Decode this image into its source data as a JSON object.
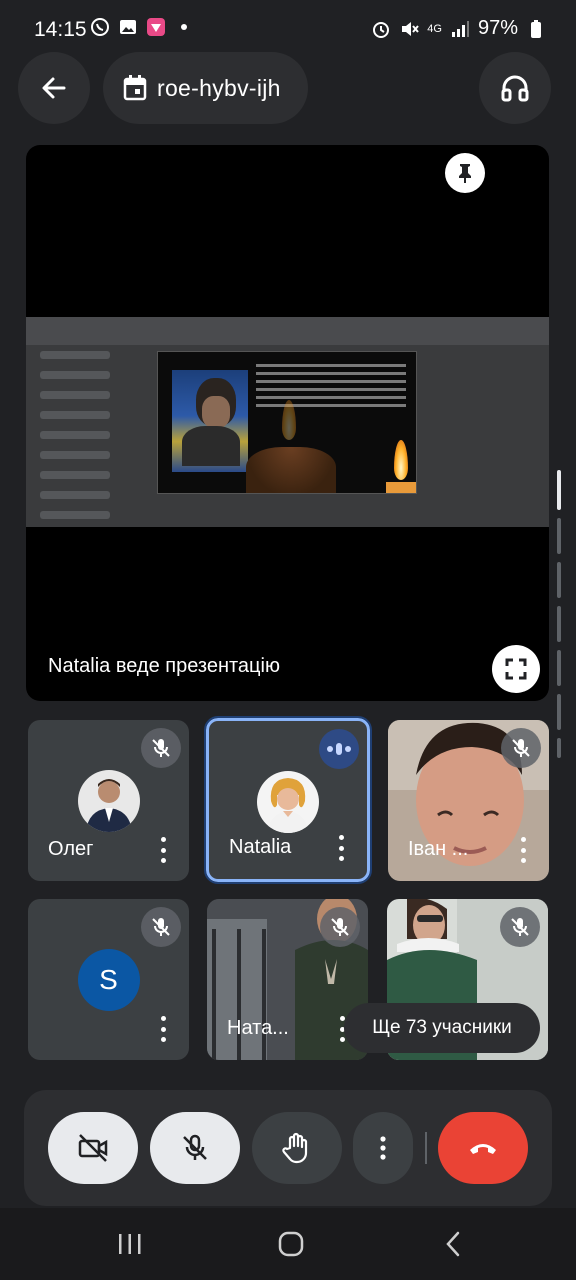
{
  "status_bar": {
    "time": "14:15",
    "battery": "97%",
    "network": "4G",
    "icons_left": [
      "viber-icon",
      "gallery-icon",
      "app-icon"
    ],
    "icons_right": [
      "alarm-icon",
      "mute-icon",
      "signal-icon",
      "battery-icon"
    ]
  },
  "top_bar": {
    "meeting_code": "roe-hybv-ijh",
    "back_icon": "arrow-back-icon",
    "calendar_icon": "calendar-icon",
    "audio_icon": "headphones-icon"
  },
  "presentation": {
    "label": "Natalia веде презентацію",
    "pin_icon": "pin-icon",
    "fullscreen_icon": "fullscreen-icon"
  },
  "participants": [
    {
      "name": "Олег",
      "muted": true,
      "avatar": "photo"
    },
    {
      "name": "Natalia",
      "muted": false,
      "speaking": true,
      "avatar": "photo"
    },
    {
      "name": "Іван ...",
      "muted": true,
      "avatar": "video"
    },
    {
      "name": "",
      "letter": "S",
      "muted": true,
      "avatar": "letter"
    },
    {
      "name": "Ната...",
      "muted": true,
      "avatar": "video"
    },
    {
      "name": "",
      "muted": true,
      "avatar": "video"
    }
  ],
  "more_participants": "Ще 73 учасники",
  "controls": {
    "camera": "camera-off-icon",
    "mic": "mic-off-icon",
    "hand": "raise-hand-icon",
    "more": "more-vert-icon",
    "end_call": "end-call-icon"
  },
  "colors": {
    "background": "#202124",
    "surface": "#2d2e31",
    "tile": "#3c4043",
    "end_call": "#ea4335",
    "speaking": "#8ab4f8",
    "letter_avatar": "#0b57a4"
  }
}
